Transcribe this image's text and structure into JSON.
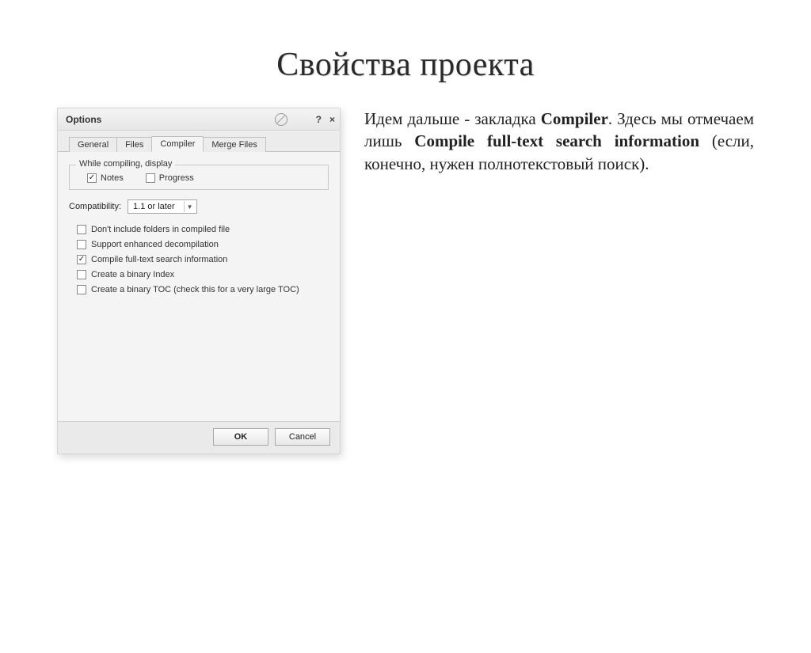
{
  "slide": {
    "title": "Свойства проекта"
  },
  "description": {
    "part1": "Идем дальше - закладка ",
    "bold1": "Compiler",
    "part2": ". Здесь мы отмечаем лишь ",
    "bold2": "Compile full-text search information",
    "part3": " (если, конечно, нужен полнотекстовый поиск)."
  },
  "dialog": {
    "title": "Options",
    "help": "?",
    "close": "×",
    "tabs": [
      "General",
      "Files",
      "Compiler",
      "Merge Files"
    ],
    "active_tab_index": 2,
    "group_legend": "While compiling, display",
    "notes_label": "Notes",
    "notes_checked": true,
    "progress_label": "Progress",
    "progress_checked": false,
    "compat_label": "Compatibility:",
    "compat_value": "1.1 or later",
    "options": [
      {
        "label": "Don't include folders in compiled file",
        "checked": false
      },
      {
        "label": "Support enhanced decompilation",
        "checked": false
      },
      {
        "label": "Compile full-text search information",
        "checked": true
      },
      {
        "label": "Create a binary Index",
        "checked": false
      },
      {
        "label": "Create a binary TOC (check this for a very large TOC)",
        "checked": false
      }
    ],
    "ok": "OK",
    "cancel": "Cancel"
  }
}
